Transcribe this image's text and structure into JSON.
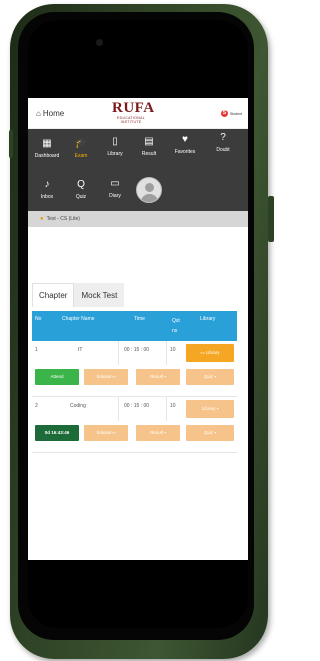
{
  "header": {
    "home_label": "Home",
    "logo_text": "RUFA",
    "logo_subtext": "EDUCATIONAL INSTITUTE",
    "user_initial": "S",
    "user_label": "Student"
  },
  "nav": {
    "items": [
      {
        "label": "Dashboard",
        "icon": "grid-icon"
      },
      {
        "label": "Exam",
        "icon": "graduation-cap-icon",
        "active": true
      },
      {
        "label": "Library",
        "icon": "document-icon"
      },
      {
        "label": "Result",
        "icon": "result-icon"
      },
      {
        "label": "Favorites",
        "icon": "heart-icon"
      },
      {
        "label": "Doubt",
        "icon": "question-icon"
      },
      {
        "label": "Inbox",
        "icon": "bell-icon"
      },
      {
        "label": "Quiz",
        "icon": "quiz-icon"
      },
      {
        "label": "Diary",
        "icon": "book-icon"
      }
    ]
  },
  "breadcrumb": "Test - CS (Lite)",
  "tabs": [
    {
      "label": "Chapter",
      "active": true
    },
    {
      "label": "Mock Test",
      "active": false
    }
  ],
  "table": {
    "headers": [
      "No",
      "Chapter Name",
      "Time",
      "Qst ns",
      "Library"
    ],
    "rows": [
      {
        "no": "1",
        "chapter": "IT",
        "time": "00 : 15 : 00",
        "qstns": "10",
        "library_button": "Library",
        "action_button": "Attend",
        "solution_button": "Solution",
        "result_button": "Result",
        "quiz_button": "Quiz"
      },
      {
        "no": "2",
        "chapter": "Coding",
        "time": "00 : 15 : 00",
        "qstns": "10",
        "library_button": "Library",
        "action_button": "0d 16:43:46",
        "solution_button": "Solution",
        "result_button": "Result",
        "quiz_button": "Quiz"
      }
    ]
  },
  "colors": {
    "phone_frame": "#2f4326",
    "nav_bg": "#3c3c3c",
    "table_header": "#29a0d8",
    "attend_green": "#3bb54a",
    "countdown_green": "#1e6b3a",
    "button_orange": "#f6c38a",
    "library_amber": "#f5a623",
    "active_nav": "#f3b200"
  }
}
